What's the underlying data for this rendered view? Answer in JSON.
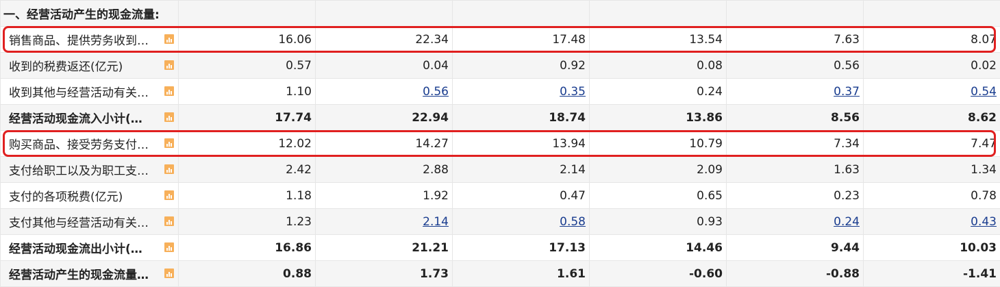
{
  "section_title": "一、经营活动产生的现金流量:",
  "rows": [
    {
      "label": "销售商品、提供劳务收到…",
      "bold": false,
      "values": [
        "16.06",
        "22.34",
        "17.48",
        "13.54",
        "7.63",
        "8.07"
      ],
      "links": [
        false,
        false,
        false,
        false,
        false,
        false
      ]
    },
    {
      "label": "收到的税费返还(亿元)",
      "bold": false,
      "values": [
        "0.57",
        "0.04",
        "0.92",
        "0.08",
        "0.56",
        "0.02"
      ],
      "links": [
        false,
        false,
        false,
        false,
        false,
        false
      ]
    },
    {
      "label": "收到其他与经营活动有关…",
      "bold": false,
      "values": [
        "1.10",
        "0.56",
        "0.35",
        "0.24",
        "0.37",
        "0.54"
      ],
      "links": [
        false,
        true,
        true,
        false,
        true,
        true
      ]
    },
    {
      "label": "经营活动现金流入小计(…",
      "bold": true,
      "values": [
        "17.74",
        "22.94",
        "18.74",
        "13.86",
        "8.56",
        "8.62"
      ],
      "links": [
        false,
        false,
        false,
        false,
        false,
        false
      ]
    },
    {
      "label": "购买商品、接受劳务支付…",
      "bold": false,
      "values": [
        "12.02",
        "14.27",
        "13.94",
        "10.79",
        "7.34",
        "7.47"
      ],
      "links": [
        false,
        false,
        false,
        false,
        false,
        false
      ]
    },
    {
      "label": "支付给职工以及为职工支…",
      "bold": false,
      "values": [
        "2.42",
        "2.88",
        "2.14",
        "2.09",
        "1.63",
        "1.34"
      ],
      "links": [
        false,
        false,
        false,
        false,
        false,
        false
      ]
    },
    {
      "label": "支付的各项税费(亿元)",
      "bold": false,
      "values": [
        "1.18",
        "1.92",
        "0.47",
        "0.65",
        "0.23",
        "0.78"
      ],
      "links": [
        false,
        false,
        false,
        false,
        false,
        false
      ]
    },
    {
      "label": "支付其他与经营活动有关…",
      "bold": false,
      "values": [
        "1.23",
        "2.14",
        "0.58",
        "0.93",
        "0.24",
        "0.43"
      ],
      "links": [
        false,
        true,
        true,
        false,
        true,
        true
      ]
    },
    {
      "label": "经营活动现金流出小计(…",
      "bold": true,
      "values": [
        "16.86",
        "21.21",
        "17.13",
        "14.46",
        "9.44",
        "10.03"
      ],
      "links": [
        false,
        false,
        false,
        false,
        false,
        false
      ]
    },
    {
      "label": "经营活动产生的现金流量…",
      "bold": true,
      "values": [
        "0.88",
        "1.73",
        "1.61",
        "-0.60",
        "-0.88",
        "-1.41"
      ],
      "links": [
        false,
        false,
        false,
        false,
        false,
        false
      ]
    }
  ],
  "highlighted_rows": [
    0,
    4
  ],
  "colors": {
    "highlight": "#e02020",
    "link": "#1a3d8f",
    "chart_icon": "#f7b05a",
    "stripe": "#f5f5f5"
  },
  "icons": {
    "row_chart": "bar-chart-icon"
  }
}
